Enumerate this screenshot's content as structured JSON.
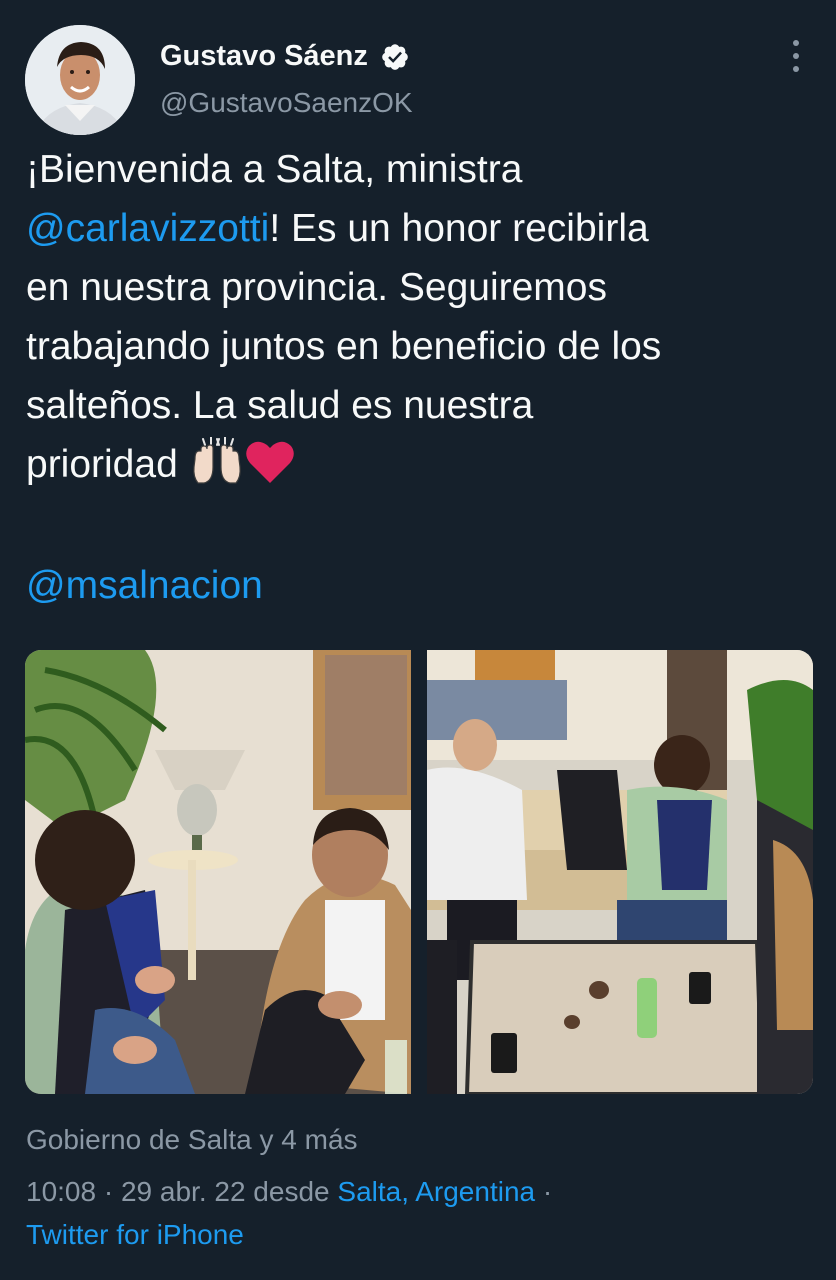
{
  "tweet": {
    "author": {
      "name": "Gustavo Sáenz",
      "handle": "@GustavoSaenzOK",
      "verified": true
    },
    "text": {
      "line1": "¡Bienvenida a Salta, ministra",
      "mention1": "@carlavizzotti",
      "line2_rest": "! Es un honor recibirla",
      "line3": "en nuestra provincia. Seguiremos",
      "line4": "trabajando juntos en beneficio de los",
      "line5": "salteños. La salud es nuestra",
      "line6": "prioridad ",
      "mention2": "@msalnacion"
    },
    "emojis": [
      "raising-hands-emoji",
      "red-heart-emoji"
    ],
    "photos": [
      "Meeting room photo with two people seated, lamp and fern",
      "Group photo with three people around a marble coffee table"
    ],
    "tagged": "Gobierno de Salta y 4 más",
    "meta": {
      "time": "10:08",
      "sep1": " · ",
      "date": "29 abr. 22",
      "from": " desde ",
      "location": "Salta, Argentina",
      "sep2": " ·"
    },
    "client": "Twitter for iPhone"
  },
  "colors": {
    "background": "#15202b",
    "text": "#f7f9f9",
    "secondary": "#8b98a5",
    "link": "#1d9bf0",
    "heart": "#e0245e"
  }
}
